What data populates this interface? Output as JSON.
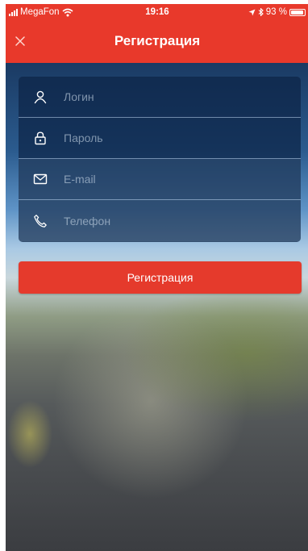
{
  "status_bar": {
    "carrier": "MegaFon",
    "time": "19:16",
    "battery": "93 %",
    "battery_level": 0.93
  },
  "nav": {
    "title": "Регистрация",
    "close_icon": "close-icon"
  },
  "form": {
    "fields": [
      {
        "icon": "user-icon",
        "placeholder": "Логин",
        "value": ""
      },
      {
        "icon": "lock-icon",
        "placeholder": "Пароль",
        "value": ""
      },
      {
        "icon": "mail-icon",
        "placeholder": "E-mail",
        "value": ""
      },
      {
        "icon": "phone-icon",
        "placeholder": "Телефон",
        "value": ""
      }
    ]
  },
  "register_button": {
    "label": "Регистрация"
  },
  "colors": {
    "accent": "#e8392b",
    "card": "#0c2446",
    "text": "#ffffff"
  }
}
